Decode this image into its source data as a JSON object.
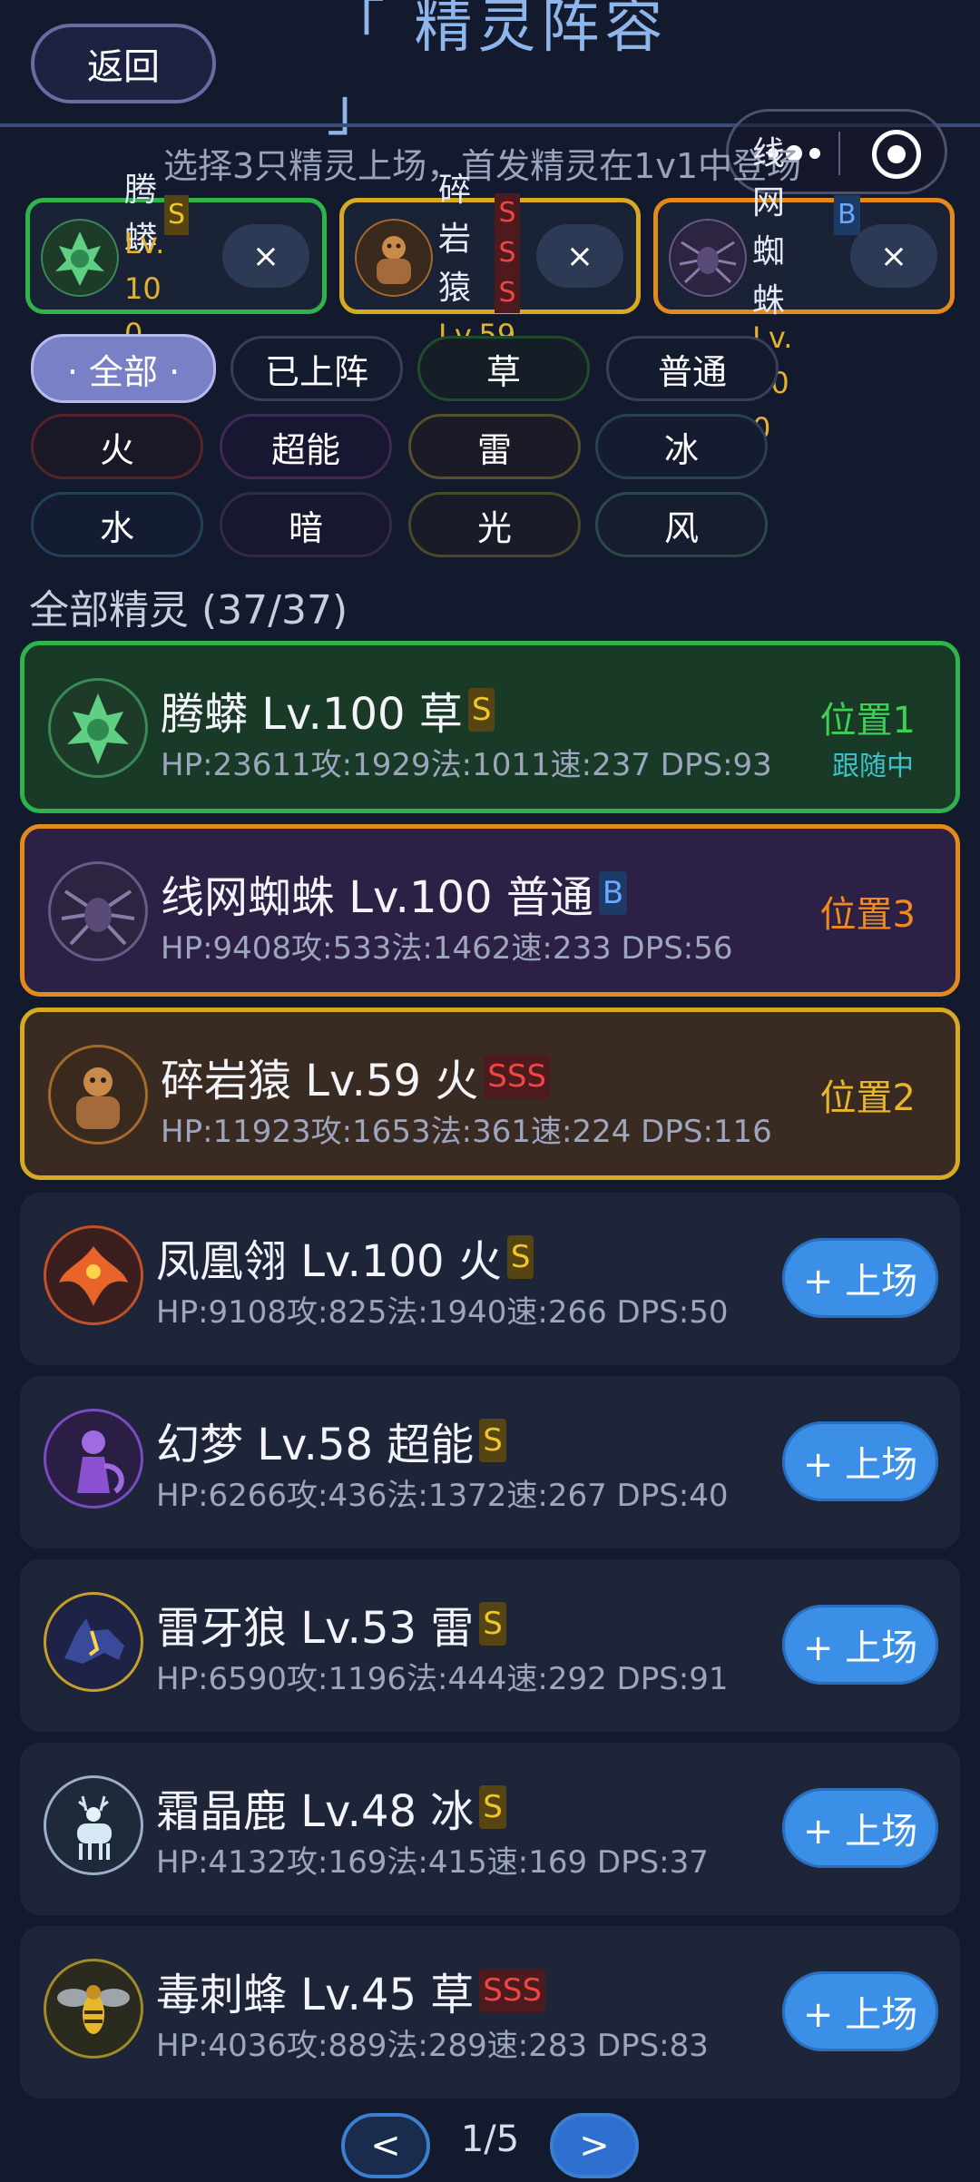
{
  "header": {
    "back_label": "返回",
    "title": "「 精灵阵容 」"
  },
  "hint": "选择3只精灵上场，首发精灵在1v1中登场",
  "team": [
    {
      "name": "腾蟒",
      "level": "Lv.100",
      "rank": "S",
      "remove": "×",
      "border": "#2fb34b"
    },
    {
      "name": "碎岩猿",
      "level": "Lv.59",
      "rank": "SSS",
      "remove": "×",
      "border": "#d8a923"
    },
    {
      "name": "线网蜘蛛",
      "level": "Lv.100",
      "rank": "B",
      "remove": "×",
      "border": "#e38a1a"
    }
  ],
  "filters": [
    "全部",
    "已上阵",
    "草",
    "普通",
    "火",
    "超能",
    "雷",
    "冰",
    "水",
    "暗",
    "光",
    "风"
  ],
  "active_filter_label": "· 全部 ·",
  "section_title": "全部精灵 (37/37)",
  "cards": [
    {
      "name": "腾蟒 Lv.100 草",
      "rank": "S",
      "stats": "HP:23611攻:1929法:1011速:237 DPS:93",
      "status": "位置1",
      "status_sub": "跟随中",
      "status_color": "#3ecf55"
    },
    {
      "name": "线网蜘蛛 Lv.100 普通",
      "rank": "B",
      "stats": "HP:9408攻:533法:1462速:233 DPS:56",
      "status": "位置3",
      "status_color": "#f08a20"
    },
    {
      "name": "碎岩猿 Lv.59 火",
      "rank": "SSS",
      "stats": "HP:11923攻:1653法:361速:224 DPS:116",
      "status": "位置2",
      "status_color": "#e8b62a"
    },
    {
      "name": "凤凰翎 Lv.100 火",
      "rank": "S",
      "stats": "HP:9108攻:825法:1940速:266 DPS:50",
      "action": "+ 上场"
    },
    {
      "name": "幻梦 Lv.58 超能",
      "rank": "S",
      "stats": "HP:6266攻:436法:1372速:267 DPS:40",
      "action": "+ 上场"
    },
    {
      "name": "雷牙狼 Lv.53 雷",
      "rank": "S",
      "stats": "HP:6590攻:1196法:444速:292 DPS:91",
      "action": "+ 上场"
    },
    {
      "name": "霜晶鹿 Lv.48 冰",
      "rank": "S",
      "stats": "HP:4132攻:169法:415速:169 DPS:37",
      "action": "+ 上场"
    },
    {
      "name": "毒刺蜂 Lv.45 草",
      "rank": "SSS",
      "stats": "HP:4036攻:889法:289速:283 DPS:83",
      "action": "+ 上场"
    }
  ],
  "pager": {
    "prev": "<",
    "text": "1/5",
    "next": ">"
  },
  "colors": {
    "accent": "#3b8fe6",
    "grass": "#2fb34b",
    "gold": "#d8a923",
    "orange": "#e38a1a"
  }
}
